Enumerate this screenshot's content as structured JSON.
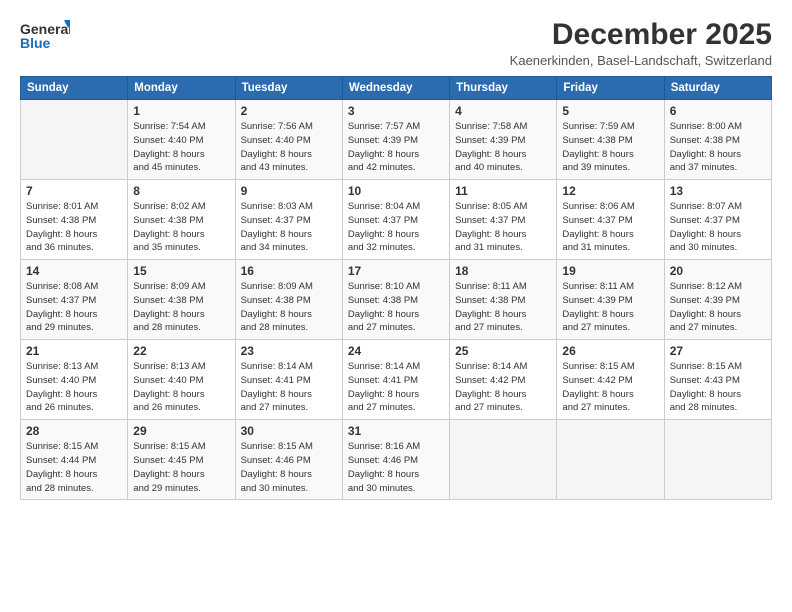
{
  "logo": {
    "line1": "General",
    "line2": "Blue"
  },
  "title": "December 2025",
  "subtitle": "Kaenerkinden, Basel-Landschaft, Switzerland",
  "headers": [
    "Sunday",
    "Monday",
    "Tuesday",
    "Wednesday",
    "Thursday",
    "Friday",
    "Saturday"
  ],
  "weeks": [
    [
      {
        "day": "",
        "content": ""
      },
      {
        "day": "1",
        "content": "Sunrise: 7:54 AM\nSunset: 4:40 PM\nDaylight: 8 hours\nand 45 minutes."
      },
      {
        "day": "2",
        "content": "Sunrise: 7:56 AM\nSunset: 4:40 PM\nDaylight: 8 hours\nand 43 minutes."
      },
      {
        "day": "3",
        "content": "Sunrise: 7:57 AM\nSunset: 4:39 PM\nDaylight: 8 hours\nand 42 minutes."
      },
      {
        "day": "4",
        "content": "Sunrise: 7:58 AM\nSunset: 4:39 PM\nDaylight: 8 hours\nand 40 minutes."
      },
      {
        "day": "5",
        "content": "Sunrise: 7:59 AM\nSunset: 4:38 PM\nDaylight: 8 hours\nand 39 minutes."
      },
      {
        "day": "6",
        "content": "Sunrise: 8:00 AM\nSunset: 4:38 PM\nDaylight: 8 hours\nand 37 minutes."
      }
    ],
    [
      {
        "day": "7",
        "content": "Sunrise: 8:01 AM\nSunset: 4:38 PM\nDaylight: 8 hours\nand 36 minutes."
      },
      {
        "day": "8",
        "content": "Sunrise: 8:02 AM\nSunset: 4:38 PM\nDaylight: 8 hours\nand 35 minutes."
      },
      {
        "day": "9",
        "content": "Sunrise: 8:03 AM\nSunset: 4:37 PM\nDaylight: 8 hours\nand 34 minutes."
      },
      {
        "day": "10",
        "content": "Sunrise: 8:04 AM\nSunset: 4:37 PM\nDaylight: 8 hours\nand 32 minutes."
      },
      {
        "day": "11",
        "content": "Sunrise: 8:05 AM\nSunset: 4:37 PM\nDaylight: 8 hours\nand 31 minutes."
      },
      {
        "day": "12",
        "content": "Sunrise: 8:06 AM\nSunset: 4:37 PM\nDaylight: 8 hours\nand 31 minutes."
      },
      {
        "day": "13",
        "content": "Sunrise: 8:07 AM\nSunset: 4:37 PM\nDaylight: 8 hours\nand 30 minutes."
      }
    ],
    [
      {
        "day": "14",
        "content": "Sunrise: 8:08 AM\nSunset: 4:37 PM\nDaylight: 8 hours\nand 29 minutes."
      },
      {
        "day": "15",
        "content": "Sunrise: 8:09 AM\nSunset: 4:38 PM\nDaylight: 8 hours\nand 28 minutes."
      },
      {
        "day": "16",
        "content": "Sunrise: 8:09 AM\nSunset: 4:38 PM\nDaylight: 8 hours\nand 28 minutes."
      },
      {
        "day": "17",
        "content": "Sunrise: 8:10 AM\nSunset: 4:38 PM\nDaylight: 8 hours\nand 27 minutes."
      },
      {
        "day": "18",
        "content": "Sunrise: 8:11 AM\nSunset: 4:38 PM\nDaylight: 8 hours\nand 27 minutes."
      },
      {
        "day": "19",
        "content": "Sunrise: 8:11 AM\nSunset: 4:39 PM\nDaylight: 8 hours\nand 27 minutes."
      },
      {
        "day": "20",
        "content": "Sunrise: 8:12 AM\nSunset: 4:39 PM\nDaylight: 8 hours\nand 27 minutes."
      }
    ],
    [
      {
        "day": "21",
        "content": "Sunrise: 8:13 AM\nSunset: 4:40 PM\nDaylight: 8 hours\nand 26 minutes."
      },
      {
        "day": "22",
        "content": "Sunrise: 8:13 AM\nSunset: 4:40 PM\nDaylight: 8 hours\nand 26 minutes."
      },
      {
        "day": "23",
        "content": "Sunrise: 8:14 AM\nSunset: 4:41 PM\nDaylight: 8 hours\nand 27 minutes."
      },
      {
        "day": "24",
        "content": "Sunrise: 8:14 AM\nSunset: 4:41 PM\nDaylight: 8 hours\nand 27 minutes."
      },
      {
        "day": "25",
        "content": "Sunrise: 8:14 AM\nSunset: 4:42 PM\nDaylight: 8 hours\nand 27 minutes."
      },
      {
        "day": "26",
        "content": "Sunrise: 8:15 AM\nSunset: 4:42 PM\nDaylight: 8 hours\nand 27 minutes."
      },
      {
        "day": "27",
        "content": "Sunrise: 8:15 AM\nSunset: 4:43 PM\nDaylight: 8 hours\nand 28 minutes."
      }
    ],
    [
      {
        "day": "28",
        "content": "Sunrise: 8:15 AM\nSunset: 4:44 PM\nDaylight: 8 hours\nand 28 minutes."
      },
      {
        "day": "29",
        "content": "Sunrise: 8:15 AM\nSunset: 4:45 PM\nDaylight: 8 hours\nand 29 minutes."
      },
      {
        "day": "30",
        "content": "Sunrise: 8:15 AM\nSunset: 4:46 PM\nDaylight: 8 hours\nand 30 minutes."
      },
      {
        "day": "31",
        "content": "Sunrise: 8:16 AM\nSunset: 4:46 PM\nDaylight: 8 hours\nand 30 minutes."
      },
      {
        "day": "",
        "content": ""
      },
      {
        "day": "",
        "content": ""
      },
      {
        "day": "",
        "content": ""
      }
    ]
  ]
}
